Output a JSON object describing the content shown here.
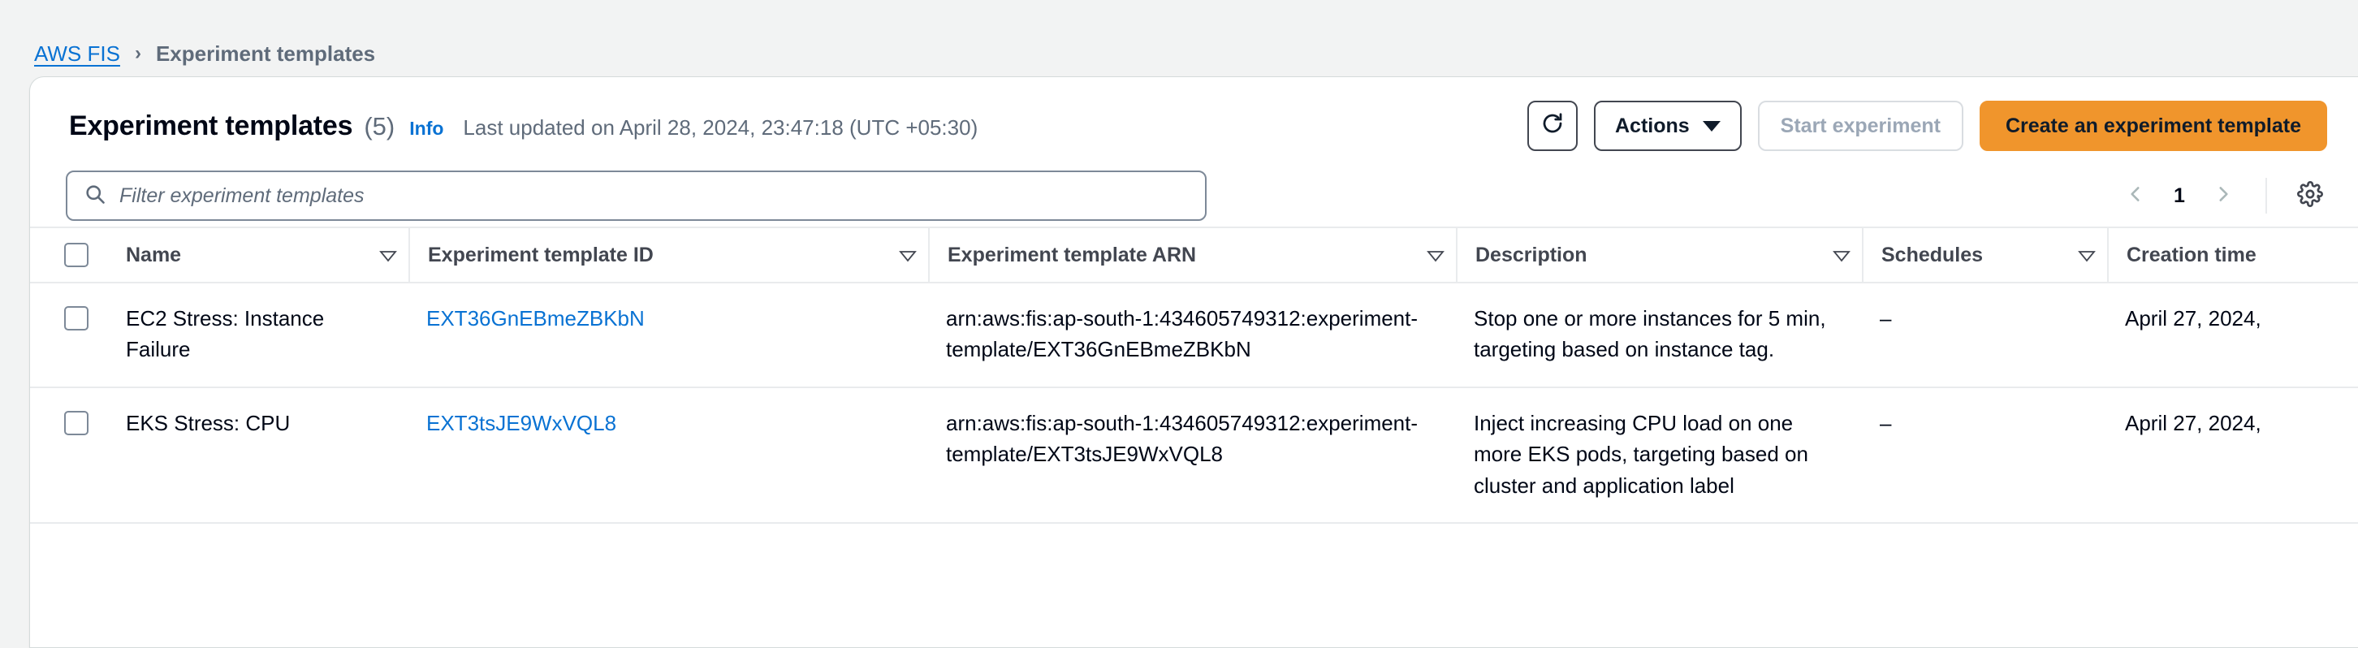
{
  "breadcrumb": {
    "root_label": "AWS FIS",
    "separator": "›",
    "current_label": "Experiment templates"
  },
  "panel": {
    "title": "Experiment templates",
    "count": "(5)",
    "info_label": "Info",
    "last_updated": "Last updated on April 28, 2024, 23:47:18 (UTC +05:30)"
  },
  "toolbar": {
    "refresh_icon": "refresh-icon",
    "actions_label": "Actions",
    "start_experiment_label": "Start experiment",
    "create_template_label": "Create an experiment template",
    "primary_color": "#f0952c",
    "link_color": "#0972d3"
  },
  "filter": {
    "placeholder": "Filter experiment templates",
    "value": "",
    "search_icon": "search-icon"
  },
  "pagination": {
    "prev_icon": "chevron-left-icon",
    "next_icon": "chevron-right-icon",
    "current_page": "1",
    "settings_icon": "gear-icon"
  },
  "table": {
    "columns": [
      {
        "label": "Name",
        "sortable": true
      },
      {
        "label": "Experiment template ID",
        "sortable": true
      },
      {
        "label": "Experiment template ARN",
        "sortable": true
      },
      {
        "label": "Description",
        "sortable": true
      },
      {
        "label": "Schedules",
        "sortable": true
      },
      {
        "label": "Creation time",
        "sortable": false
      }
    ],
    "rows": [
      {
        "name": "EC2 Stress: Instance Failure",
        "template_id": "EXT36GnEBmeZBKbN",
        "arn": "arn:aws:fis:ap-south-1:434605749312:experiment-template/EXT36GnEBmeZBKbN",
        "description": "Stop one or more instances for 5 min, targeting based on instance tag.",
        "schedules": "–",
        "creation_time": "April 27, 2024, "
      },
      {
        "name": "EKS Stress: CPU",
        "template_id": "EXT3tsJE9WxVQL8",
        "arn": "arn:aws:fis:ap-south-1:434605749312:experiment-template/EXT3tsJE9WxVQL8",
        "description": "Inject increasing CPU load on one more EKS pods, targeting based on cluster and application label",
        "schedules": "–",
        "creation_time": "April 27, 2024, "
      }
    ]
  }
}
